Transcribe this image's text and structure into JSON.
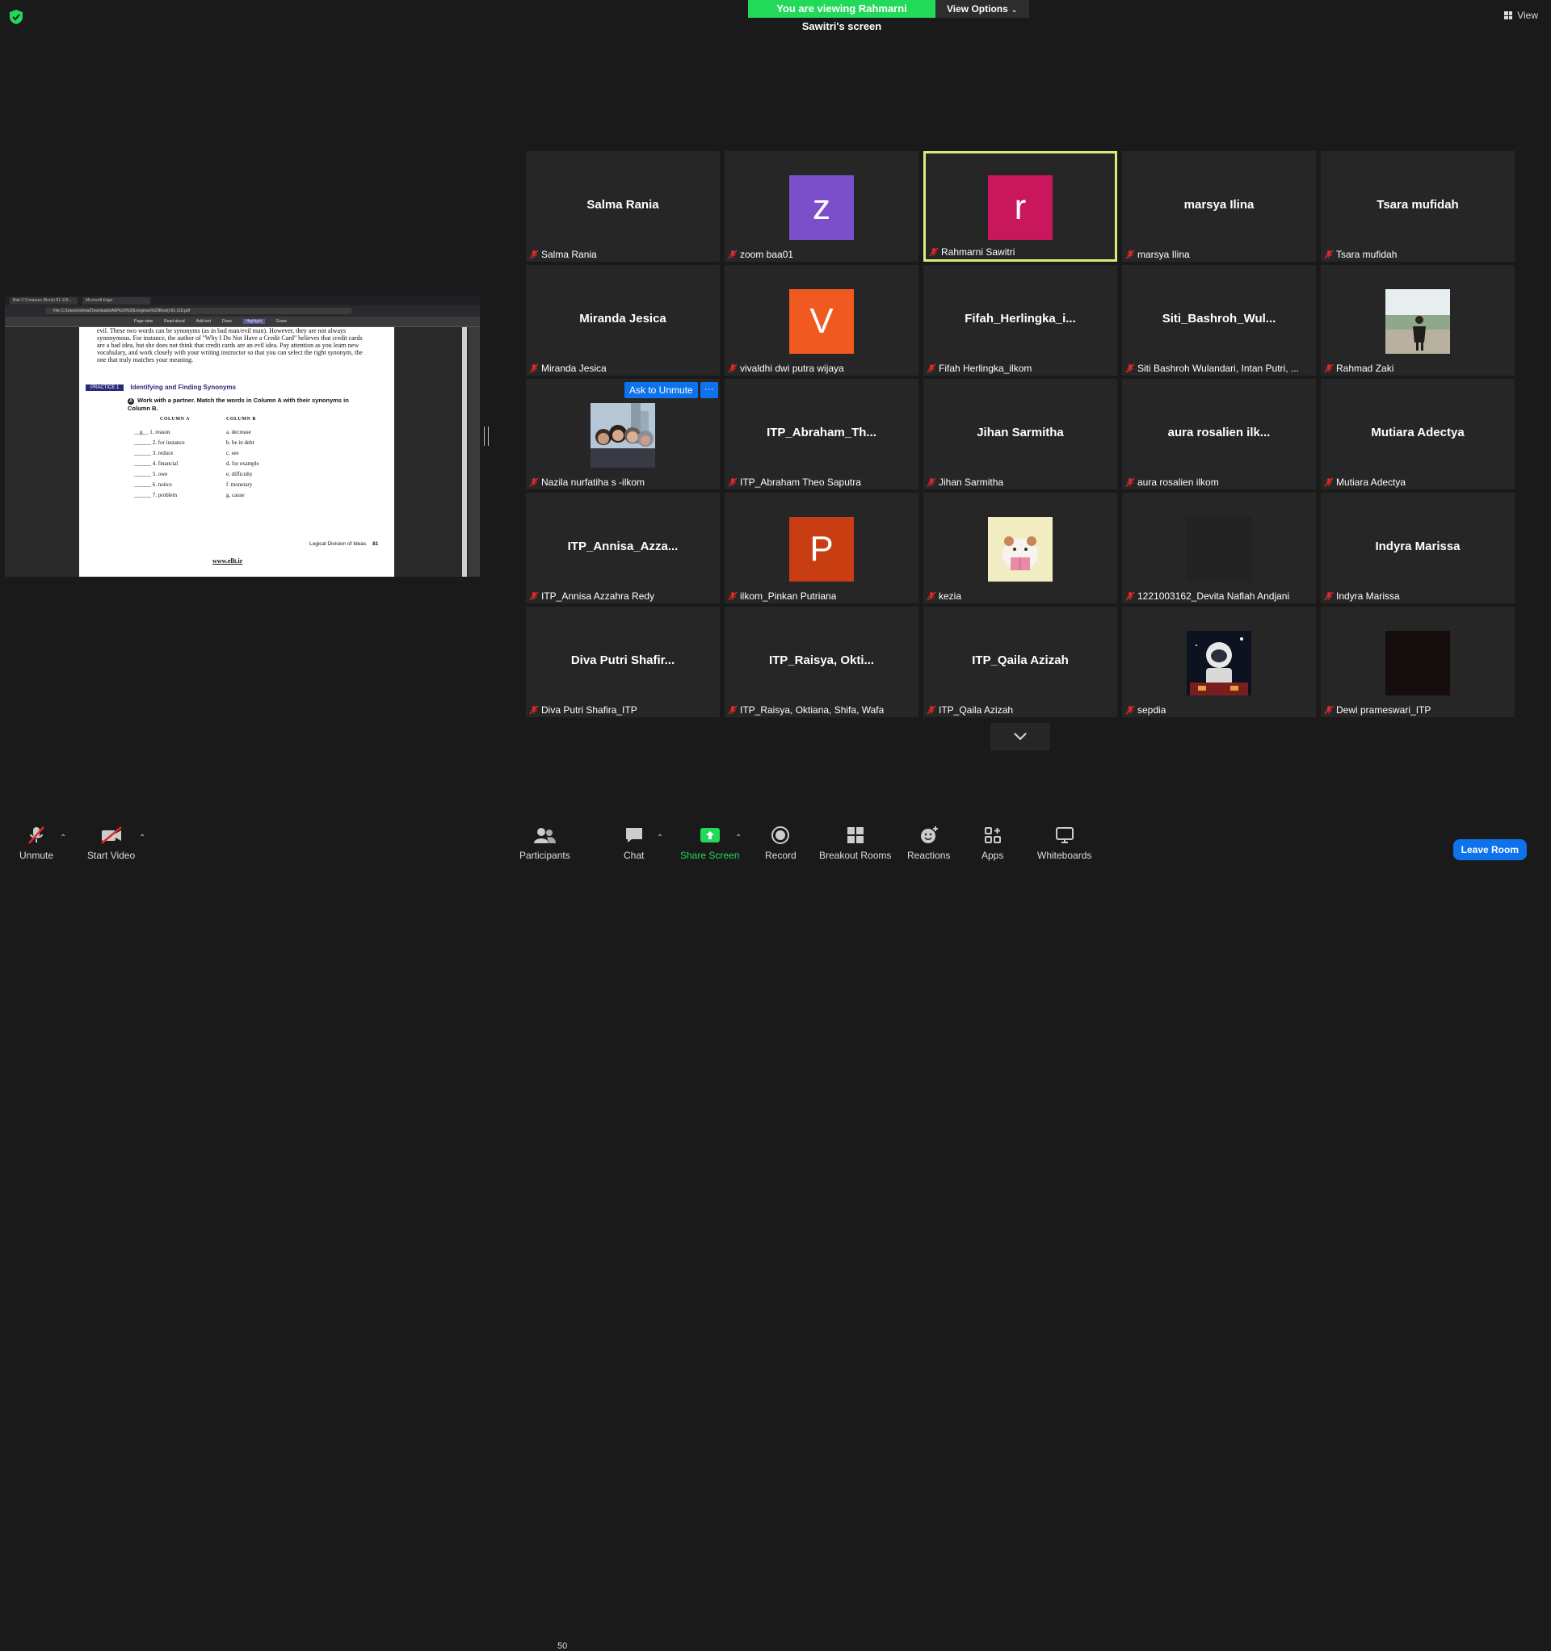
{
  "banner": {
    "viewing_text": "You are viewing Rahmarni Sawitri's screen",
    "view_options": "View Options"
  },
  "top_right": {
    "view_label": "View"
  },
  "shared_screen": {
    "tabs": [
      "Bab 3 Compose (Book) 81-118...",
      "Microsoft Edge"
    ],
    "address": "File   C:/Users/rahma/Downloads/AW%20%28Longman%20Book)-81-118.pdf",
    "toolbar": [
      "Page view",
      "Read aloud",
      "Add text",
      "Draw",
      "Highlight",
      "Erase"
    ],
    "paragraph": "evil. These two words can be synonyms (as in bad man/evil man). However, they are not always synonymous. For instance, the author of \"Why I Do Not Have a Credit Card\" believes that credit cards are a bad idea, but she does not think that credit cards are an evil idea. Pay attention as you learn new vocabulary, and work closely with your writing instructor so that you can select the right synonym, the one that truly matches your meaning.",
    "practice_badge": "PRACTICE 1",
    "practice_title": "Identifying and Finding Synonyms",
    "instruction_mark": "A",
    "instruction": "Work with a partner. Match the words in Column A with their synonyms in Column B.",
    "col_a_head": "COLUMN A",
    "col_b_head": "COLUMN B",
    "col_a": [
      "__g__ 1. reason",
      "______ 2. for instance",
      "______ 3. reduce",
      "______ 4. financial",
      "______ 5. owe",
      "______ 6. notice",
      "______ 7. problem"
    ],
    "col_b": [
      "a. decrease",
      "b. be in debt",
      "c. see",
      "d. for example",
      "e. difficulty",
      "f. monetary",
      "g. cause"
    ],
    "footer_title": "Logical Division of Ideas",
    "footer_page": "81",
    "url": "www.ellt.ir"
  },
  "participants": [
    {
      "center": "Salma Rania",
      "label": "Salma Rania"
    },
    {
      "avatar": "z",
      "color": "#7b4fc9",
      "label": "zoom baa01"
    },
    {
      "avatar": "r",
      "color": "#c8175a",
      "label": "Rahmarni Sawitri",
      "active": true
    },
    {
      "center": "marsya Ilina",
      "label": "marsya Ilina"
    },
    {
      "center": "Tsara mufidah",
      "label": "Tsara mufidah"
    },
    {
      "center": "Miranda Jesica",
      "label": "Miranda Jesica"
    },
    {
      "avatar": "V",
      "color": "#f0591f",
      "label": "vivaldhi dwi putra wijaya"
    },
    {
      "center": "Fifah_Herlingka_i...",
      "label": "Fifah Herlingka_ilkom"
    },
    {
      "center": "Siti_Bashroh_Wul...",
      "label": "Siti Bashroh Wulandari, Intan Putri, ..."
    },
    {
      "photo": "person-outdoor",
      "label": "Rahmad Zaki"
    },
    {
      "photo": "group-selfie",
      "label": "Nazila nurfatiha s -ilkom",
      "ask": true
    },
    {
      "center": "ITP_Abraham_Th...",
      "label": "ITP_Abraham Theo Saputra"
    },
    {
      "center": "Jihan Sarmitha",
      "label": "Jihan Sarmitha"
    },
    {
      "center": "aura rosalien ilk...",
      "label": "aura rosalien ilkom"
    },
    {
      "center": "Mutiara Adectya",
      "label": "Mutiara Adectya"
    },
    {
      "center": "ITP_Annisa_Azza...",
      "label": "ITP_Annisa Azzahra Redy"
    },
    {
      "avatar": "P",
      "color": "#c93d12",
      "label": "ilkom_Pinkan Putriana"
    },
    {
      "photo": "hamster-cartoon",
      "label": "kezia"
    },
    {
      "photo": "dark",
      "label": "1221003162_Devita Naflah Andjani"
    },
    {
      "center": "Indyra Marissa",
      "label": "Indyra Marissa"
    },
    {
      "center": "Diva Putri Shafir...",
      "label": "Diva Putri Shafira_ITP"
    },
    {
      "center": "ITP_Raisya, Okti...",
      "label": "ITP_Raisya, Oktiana, Shifa, Wafa"
    },
    {
      "center": "ITP_Qaila Azizah",
      "label": "ITP_Qaila Azizah"
    },
    {
      "photo": "astronaut",
      "label": "sepdia"
    },
    {
      "photo": "black",
      "label": "Dewi prameswari_ITP"
    }
  ],
  "ask_to_unmute": "Ask to Unmute",
  "more_glyph": "···",
  "toolbar": {
    "unmute": "Unmute",
    "start_video": "Start Video",
    "participants": "Participants",
    "participants_count": "50",
    "chat": "Chat",
    "share_screen": "Share Screen",
    "record": "Record",
    "breakout_rooms": "Breakout Rooms",
    "reactions": "Reactions",
    "apps": "Apps",
    "whiteboards": "Whiteboards",
    "leave": "Leave Room"
  },
  "colors": {
    "share_green": "#23d959",
    "leave_blue": "#0e72ed",
    "active_border": "#d7ed7a",
    "mute_red": "#e02828"
  }
}
